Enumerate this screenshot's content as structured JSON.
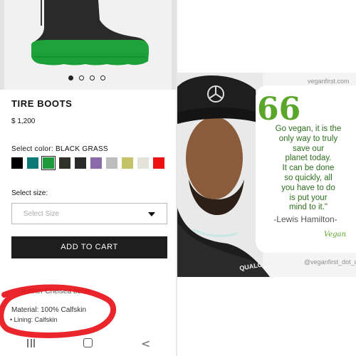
{
  "product": {
    "carousel_dots": 4,
    "carousel_active_index": 0,
    "title": "TIRE BOOTS",
    "price": "$ 1,200",
    "color_label": "Select color: BLACK GRASS",
    "swatches": [
      "#000000",
      "#0a7a78",
      "#1e9a3a",
      "#2e3228",
      "#2a2a2a",
      "#8a6aa8",
      "#bdbdbd",
      "#c5c36a",
      "#e3e3da",
      "#ee1111"
    ],
    "selected_swatch_index": 2,
    "size_label": "Select size:",
    "size_placeholder": "Select Size",
    "add_to_cart": "ADD TO CART",
    "description": "leather Chelsea boots",
    "material": "Material: 100% Calfskin",
    "lining": "• Lining: Calfskin"
  },
  "nav": {
    "icons": [
      "menu-icon",
      "home-icon",
      "back-icon"
    ],
    "back_glyph": "<"
  },
  "annotation": {
    "color": "#e8141a",
    "shape": "hand-drawn circle around product details"
  },
  "quote_image": {
    "site_top": "veganfirst.com",
    "quote_mark": "66",
    "quote_lines": [
      "Go vegan, it is the",
      "only way to truly",
      "save our",
      "planet today.",
      "It can be done",
      "so quickly, all",
      "you have to do",
      "is put your",
      "mind to it.\""
    ],
    "author": "-Lewis Hamilton-",
    "logo": "Vegan",
    "cap_brand": "Mercedes",
    "shirt_text": "QUALCOMM",
    "handle": "@veganfirst_dot_com",
    "accent": "#5aa62a"
  }
}
